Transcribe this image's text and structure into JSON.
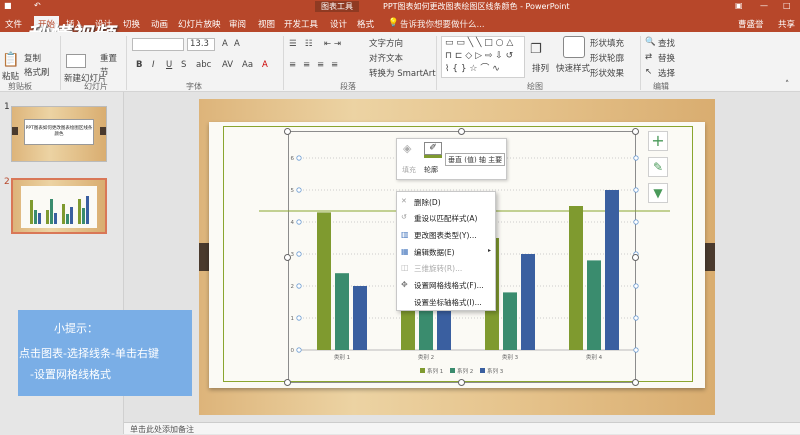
{
  "title_bar": {
    "chart_tools": "图表工具",
    "doc_title": "PPT图表如何更改图表绘图区线条颜色 - PowerPoint"
  },
  "tabs": [
    "文件",
    "开始",
    "插入",
    "设计",
    "切换",
    "动画",
    "幻灯片放映",
    "审阅",
    "视图",
    "开发工具",
    "设计",
    "格式"
  ],
  "tell_me": "告诉我你想要做什么...",
  "user": "曹盛誉",
  "share": "共享",
  "watermark": "秒懂视频",
  "ribbon": {
    "clipboard": {
      "copy": "复制",
      "paste": "粘贴",
      "format_painter": "格式刷",
      "label": "剪贴板"
    },
    "slides": {
      "new_slide": "新建幻灯片",
      "reset": "重置",
      "section": "节",
      "label": "幻灯片"
    },
    "font": {
      "size": "13.3",
      "label": "字体"
    },
    "paragraph": {
      "text_dir": "文字方向",
      "align_text": "对齐文本",
      "smartart": "转换为 SmartArt",
      "label": "段落"
    },
    "drawing": {
      "arrange": "排列",
      "quick_styles": "快速样式",
      "shape_fill": "形状填充",
      "shape_outline": "形状轮廓",
      "shape_effects": "形状效果",
      "label": "绘图"
    },
    "editing": {
      "find": "查找",
      "replace": "替换",
      "select": "选择",
      "label": "编辑"
    }
  },
  "slides_pane": {
    "slide1_num": "1",
    "slide1_text": "PPT图表如何更改图表绘图区线条颜色",
    "slide2_num": "2"
  },
  "chart_data": {
    "type": "bar",
    "categories": [
      "类别 1",
      "类别 2",
      "类别 3",
      "类别 4"
    ],
    "series": [
      {
        "name": "系列 1",
        "values": [
          4.3,
          2.5,
          3.5,
          4.5
        ],
        "color": "#7f9a2f"
      },
      {
        "name": "系列 2",
        "values": [
          2.4,
          4.4,
          1.8,
          2.8
        ],
        "color": "#3a8c6e"
      },
      {
        "name": "系列 3",
        "values": [
          2.0,
          2.0,
          3.0,
          5.0
        ],
        "color": "#3a5fa0"
      }
    ],
    "y_ticks": [
      "0",
      "1",
      "2",
      "3",
      "4",
      "5",
      "6"
    ],
    "ylim": [
      0,
      6
    ],
    "grid": true,
    "legend": "bottom"
  },
  "mini_toolbar": {
    "fill": "填充",
    "outline": "轮廓",
    "element": "垂直 (值) 轴 主要"
  },
  "context_menu": [
    "删除(D)",
    "重设以匹配样式(A)",
    "更改图表类型(Y)...",
    "编辑数据(E)",
    "三维旋转(R)...",
    "设置网格线格式(F)...",
    "设置坐标轴格式(I)..."
  ],
  "tip": {
    "title": "小提示：",
    "line1": "点击图表-选择线条-单击右键",
    "line2": "-设置网格线格式"
  },
  "notes": "单击此处添加备注",
  "colors": {
    "accent": "#b7472a",
    "tip_bg": "#7aaee6"
  }
}
